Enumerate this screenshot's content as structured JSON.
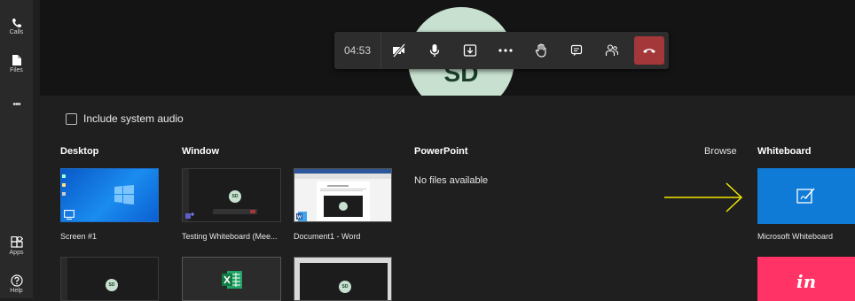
{
  "rail": {
    "calls": "Calls",
    "files": "Files",
    "more": "•••",
    "apps": "Apps",
    "help": "Help"
  },
  "call": {
    "timer": "04:53",
    "avatar_initials": "SD"
  },
  "share": {
    "include_audio": "Include system audio",
    "columns": {
      "desktop": "Desktop",
      "window": "Window",
      "powerpoint": "PowerPoint",
      "browse": "Browse",
      "whiteboard": "Whiteboard"
    },
    "no_files": "No files available",
    "captions": {
      "screen1": "Screen #1",
      "window1": "Testing Whiteboard (Mee...",
      "window2": "Document1 - Word",
      "whiteboard1": "Microsoft Whiteboard"
    },
    "thumb_avatar": "SD",
    "invision_label": "in"
  },
  "colors": {
    "hangup": "#a4373a",
    "whiteboard": "#0f7bd7",
    "invision": "#ff3366",
    "arrow": "#f2e600"
  }
}
